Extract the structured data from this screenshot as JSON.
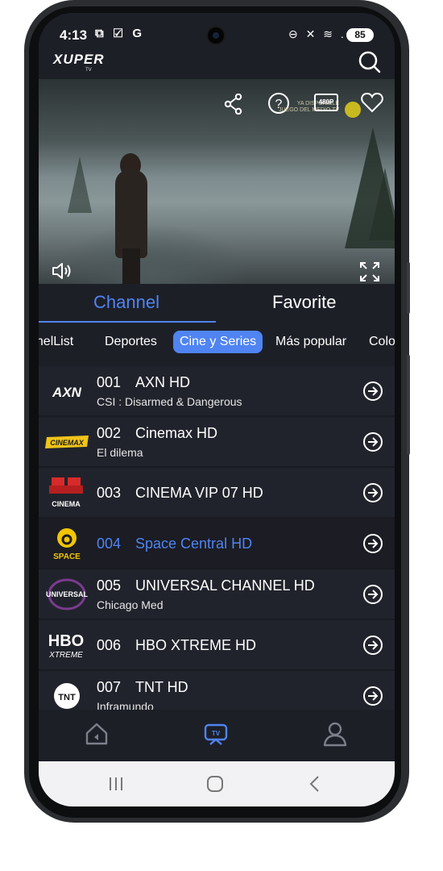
{
  "status_bar": {
    "time": "4:13",
    "left_icons": "⧉ ☑ G",
    "right_icons": "⊖ ✕ ≋ .ıl",
    "battery": "85"
  },
  "app": {
    "logo": "XUPER",
    "logo_sub": "TV"
  },
  "player": {
    "quality": "480P",
    "promo_line1": "YA DISPONIBLE",
    "promo_line2": "JUEGO DEL MEDIO TV",
    "icons": [
      "share-icon",
      "help-icon",
      "quality-icon",
      "favorite-icon",
      "volume-icon",
      "fullscreen-icon"
    ]
  },
  "tabs": [
    {
      "label": "Channel",
      "active": true
    },
    {
      "label": "Favorite",
      "active": false
    }
  ],
  "categories": [
    {
      "label": "ChannelList",
      "shown": "nnelList"
    },
    {
      "label": "Deportes"
    },
    {
      "label": "Cine y Series",
      "active": true
    },
    {
      "label": "Más popular"
    },
    {
      "label": "Colo"
    }
  ],
  "channels": [
    {
      "number": "001",
      "name": "AXN HD",
      "program": "CSI : Disarmed & Dangerous",
      "logo": "AXN"
    },
    {
      "number": "002",
      "name": "Cinemax HD",
      "program": "El dilema",
      "logo": "CINEMAX"
    },
    {
      "number": "003",
      "name": "CINEMA VIP 07 HD",
      "program": "",
      "logo": "CINEMA"
    },
    {
      "number": "004",
      "name": "Space Central HD",
      "program": "",
      "logo": "SPACE",
      "selected": true
    },
    {
      "number": "005",
      "name": "UNIVERSAL CHANNEL HD",
      "program": "Chicago Med",
      "logo": "UNIVERSAL"
    },
    {
      "number": "006",
      "name": "HBO XTREME HD",
      "program": "",
      "logo": "HBO"
    },
    {
      "number": "007",
      "name": "TNT HD",
      "program": "Inframundo",
      "logo": "TNT"
    }
  ],
  "bottom_nav": [
    {
      "icon": "home-icon",
      "active": false
    },
    {
      "icon": "tv-icon",
      "label": "TV",
      "active": true
    },
    {
      "icon": "profile-icon",
      "active": false
    }
  ],
  "colors": {
    "accent": "#4f84f2",
    "background": "#21232c",
    "bar": "#1d1f27"
  }
}
